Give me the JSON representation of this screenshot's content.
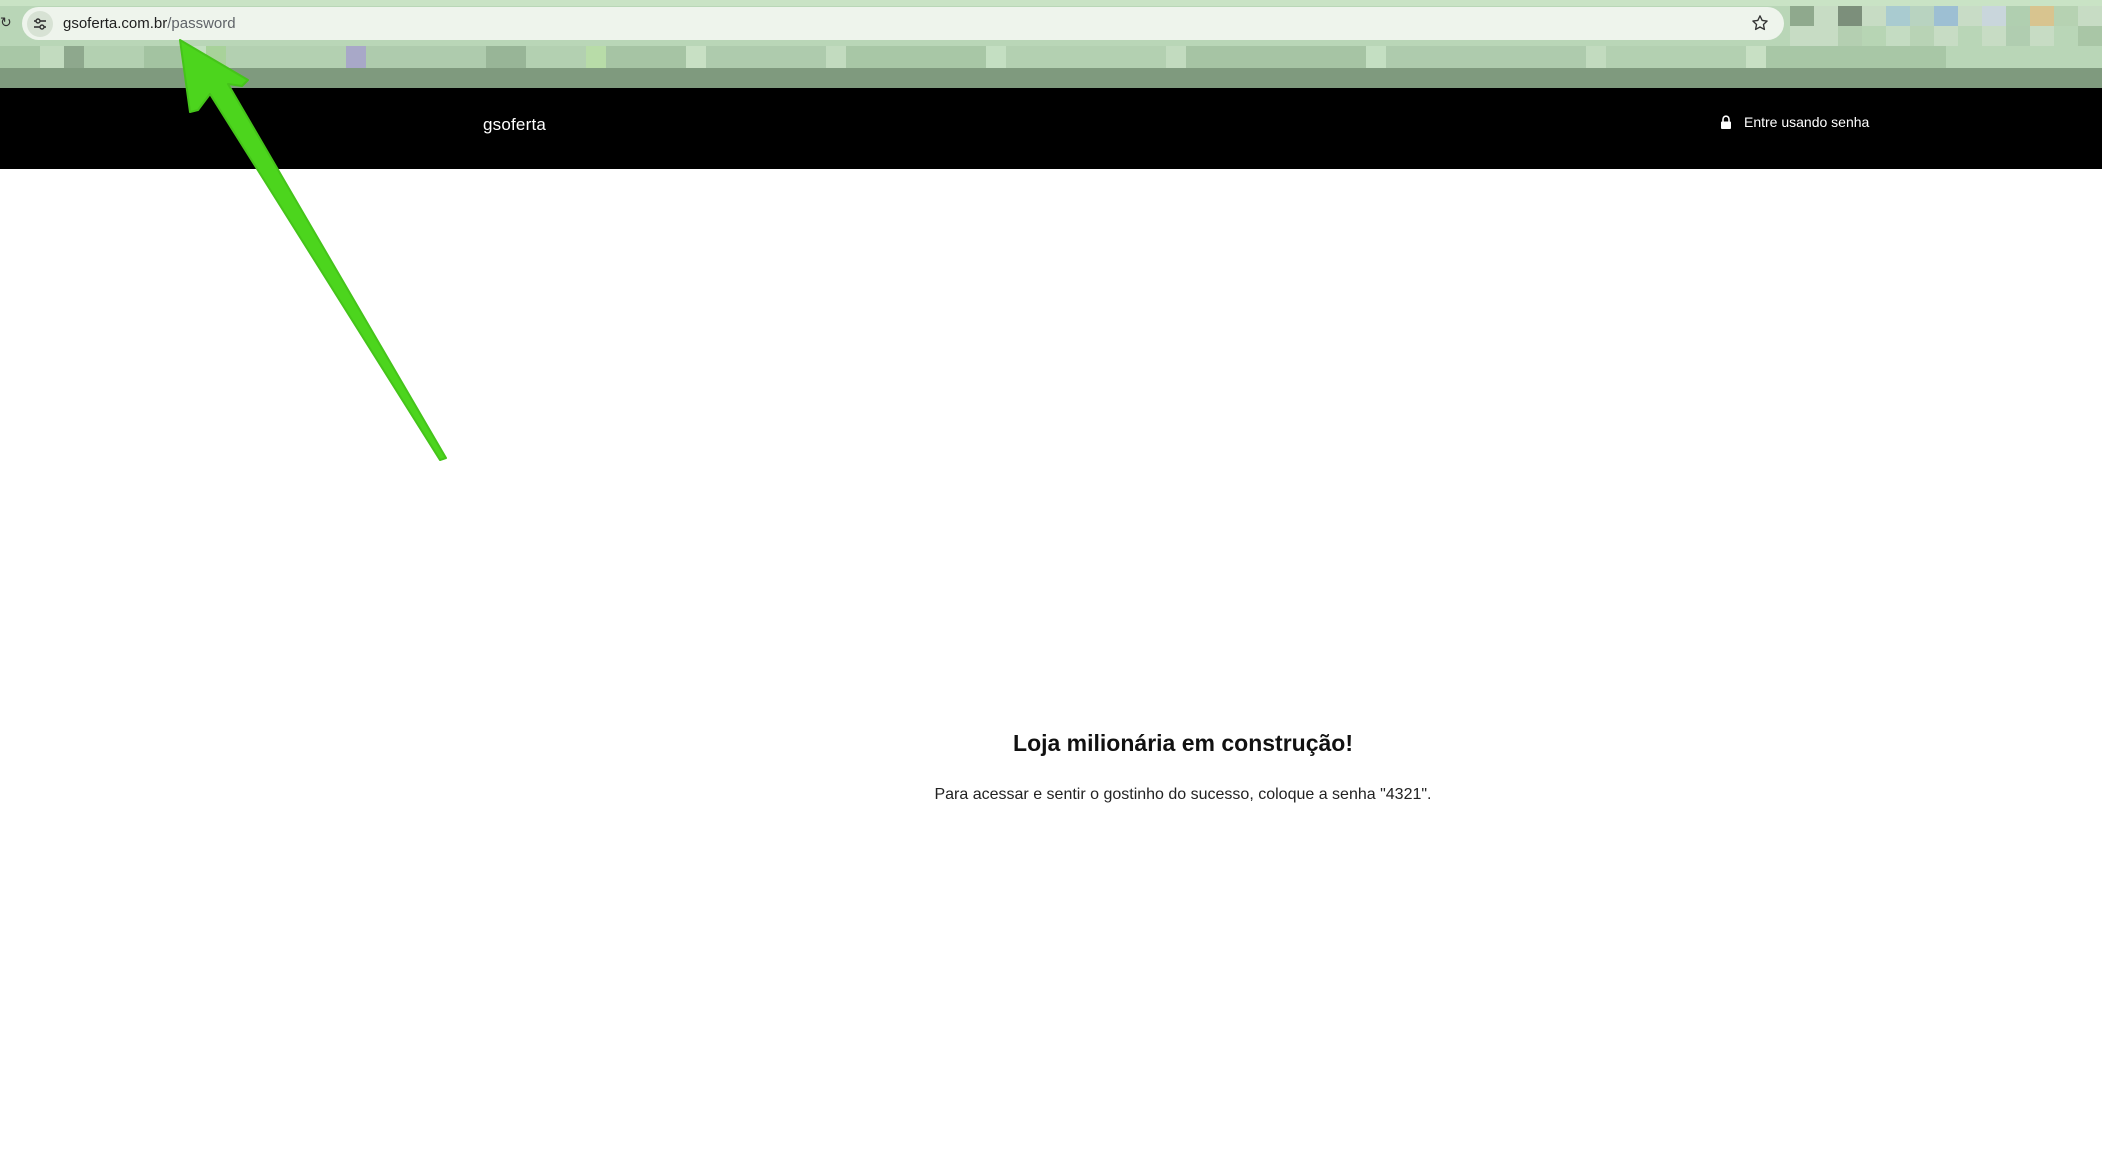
{
  "browser": {
    "url_host": "gsoferta.com.br",
    "url_path": "/password",
    "site_info_icon": "tune-icon",
    "bookmark_icon": "star-icon"
  },
  "header": {
    "brand": "gsoferta",
    "login_label": "Entre usando senha",
    "login_icon": "lock-icon"
  },
  "main": {
    "title": "Loja milionária em construção!",
    "message": "Para acessar e sentir o gostinho do sucesso, coloque a senha \"4321\"."
  },
  "annotation": {
    "arrow_color": "#4cd51d",
    "arrow_icon": "arrow-annotation"
  }
}
